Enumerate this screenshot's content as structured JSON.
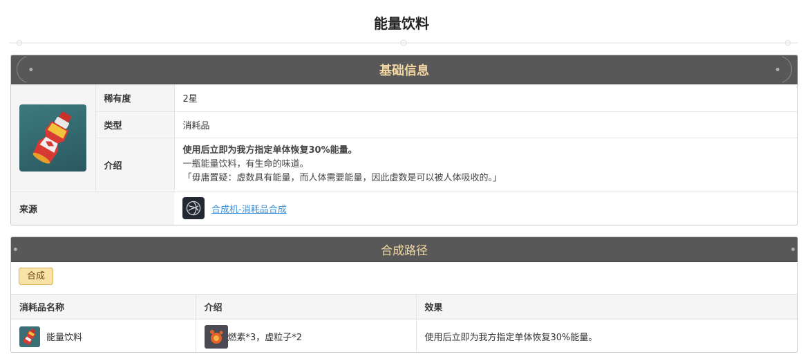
{
  "page": {
    "title": "能量饮料"
  },
  "basic": {
    "header": "基础信息",
    "rarity_label": "稀有度",
    "rarity_value": "2星",
    "type_label": "类型",
    "type_value": "消耗品",
    "intro_label": "介绍",
    "intro_bold": "使用后立即为我方指定单体恢复30%能量。",
    "intro_line1": "一瓶能量饮料，有生命的味道。",
    "intro_line2": "「毋庸置疑：虚数具有能量，而人体需要能量，因此虚数是可以被人体吸收的。」",
    "source_label": "来源",
    "source_link": "合成机-消耗品合成"
  },
  "synthesis": {
    "header": "合成路径",
    "tab_label": "合成",
    "columns": [
      "消耗品名称",
      "介绍",
      "效果"
    ],
    "rows": [
      {
        "name": "能量饮料",
        "materials": "燃素*3，虚粒子*2",
        "effect": "使用后立即为我方指定单体恢复30%能量。"
      }
    ]
  },
  "colors": {
    "header_bg": "#585858",
    "header_text": "#f3d7a3",
    "tab_bg": "#f9e2a6",
    "link": "#3a8fd6"
  }
}
